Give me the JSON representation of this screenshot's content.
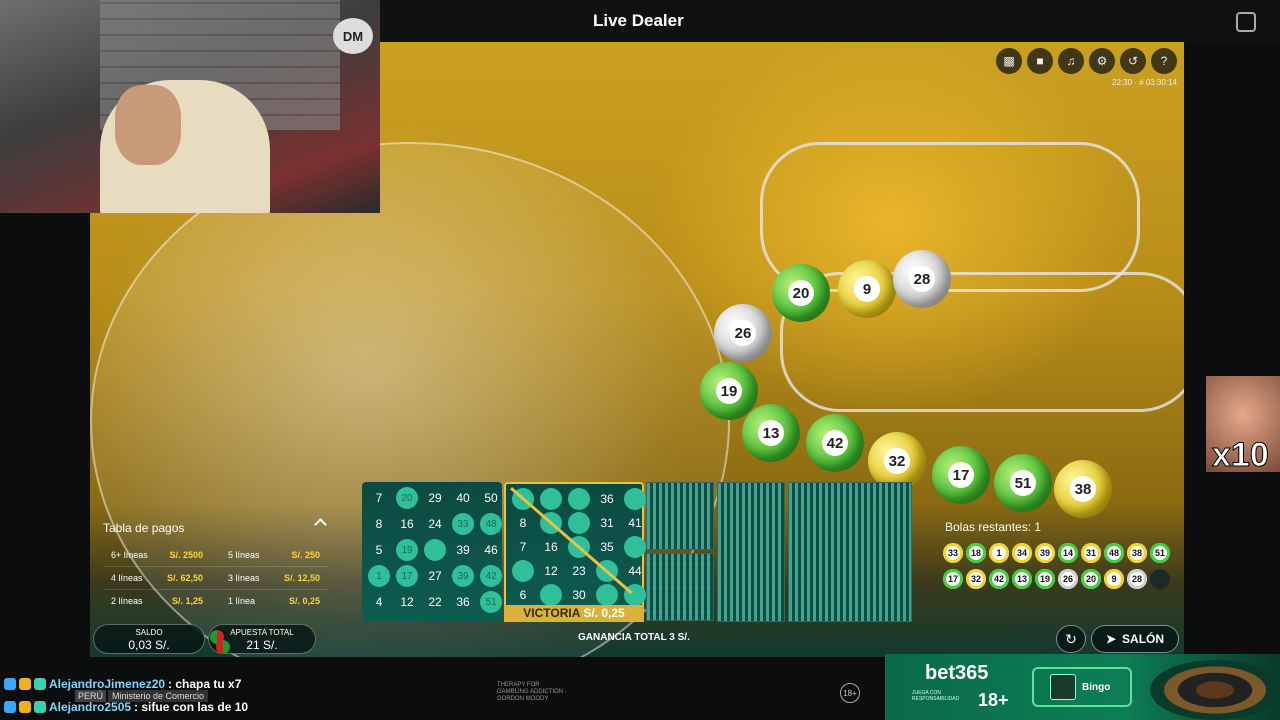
{
  "header": {
    "title": "Live Dealer"
  },
  "toolbar": {
    "icons": [
      "chat-icon",
      "video-icon",
      "volume-icon",
      "gear-icon",
      "history-icon",
      "help-icon"
    ],
    "stream_time": "22:30 · # 03:30:14"
  },
  "webcam": {
    "logo": "DM"
  },
  "video_balls": [
    {
      "n": "20",
      "c": "green"
    },
    {
      "n": "9",
      "c": "yellow"
    },
    {
      "n": "28",
      "c": "white"
    },
    {
      "n": "26",
      "c": "white"
    },
    {
      "n": "19",
      "c": "green"
    },
    {
      "n": "13",
      "c": "green"
    },
    {
      "n": "42",
      "c": "green"
    },
    {
      "n": "32",
      "c": "yellow"
    },
    {
      "n": "17",
      "c": "green"
    },
    {
      "n": "51",
      "c": "green"
    },
    {
      "n": "38",
      "c": "yellow"
    }
  ],
  "paytable": {
    "title": "Tabla de pagos",
    "rows": [
      {
        "l1": "6+ líneas",
        "v1": "S/. 2500",
        "l2": "5 líneas",
        "v2": "S/. 250"
      },
      {
        "l1": "4 líneas",
        "v1": "S/. 62,50",
        "l2": "3 líneas",
        "v2": "S/. 12,50"
      },
      {
        "l1": "2 líneas",
        "v1": "S/. 1,25",
        "l2": "1 línea",
        "v2": "S/. 0,25"
      }
    ]
  },
  "balance": {
    "label": "SALDO",
    "value": "0,03 S/."
  },
  "bet": {
    "label": "APUESTA TOTAL",
    "value": "21 S/."
  },
  "cards": [
    {
      "cells": [
        [
          "7",
          "20",
          "29",
          "40",
          "50"
        ],
        [
          "8",
          "16",
          "24",
          "33",
          "48"
        ],
        [
          "5",
          "19",
          "",
          "39",
          "46"
        ],
        [
          "1",
          "17",
          "27",
          "39",
          "42"
        ],
        [
          "4",
          "12",
          "22",
          "36",
          "51"
        ]
      ],
      "marked": [
        [
          0,
          1
        ],
        [
          1,
          3
        ],
        [
          1,
          4
        ],
        [
          2,
          1
        ],
        [
          2,
          2
        ],
        [
          3,
          0
        ],
        [
          3,
          1
        ],
        [
          3,
          3
        ],
        [
          3,
          4
        ],
        [
          4,
          4
        ]
      ]
    },
    {
      "cells": [
        [
          "",
          "",
          "",
          "36",
          ""
        ],
        [
          "8",
          "",
          "",
          "31",
          "41"
        ],
        [
          "7",
          "16",
          "",
          "35",
          ""
        ],
        [
          "",
          "12",
          "23",
          "",
          "44"
        ],
        [
          "6",
          "",
          "30",
          "",
          ""
        ]
      ],
      "marked": [
        [
          0,
          0
        ],
        [
          0,
          1
        ],
        [
          0,
          2
        ],
        [
          0,
          4
        ],
        [
          1,
          1
        ],
        [
          1,
          2
        ],
        [
          2,
          2
        ],
        [
          2,
          4
        ],
        [
          3,
          0
        ],
        [
          3,
          3
        ],
        [
          4,
          1
        ],
        [
          4,
          3
        ],
        [
          4,
          4
        ]
      ]
    }
  ],
  "victory": {
    "label": "VICTORIA",
    "amount": "S/. 0,25"
  },
  "total_win": {
    "label": "GANANCIA TOTAL",
    "amount": "3 S/."
  },
  "drawn": {
    "label": "Bolas restantes: 1",
    "balls": [
      {
        "n": "33",
        "c": "yellow"
      },
      {
        "n": "18",
        "c": "green"
      },
      {
        "n": "1",
        "c": "yellow"
      },
      {
        "n": "34",
        "c": "yellow"
      },
      {
        "n": "39",
        "c": "yellow"
      },
      {
        "n": "14",
        "c": "green"
      },
      {
        "n": "31",
        "c": "yellow"
      },
      {
        "n": "48",
        "c": "green"
      },
      {
        "n": "38",
        "c": "yellow"
      },
      {
        "n": "51",
        "c": "green"
      },
      {
        "n": "17",
        "c": "green"
      },
      {
        "n": "32",
        "c": "yellow"
      },
      {
        "n": "42",
        "c": "green"
      },
      {
        "n": "13",
        "c": "green"
      },
      {
        "n": "19",
        "c": "green"
      },
      {
        "n": "26",
        "c": "white"
      },
      {
        "n": "20",
        "c": "green"
      },
      {
        "n": "9",
        "c": "yellow"
      },
      {
        "n": "28",
        "c": "white"
      },
      {
        "n": "",
        "c": "empty"
      }
    ]
  },
  "buttons": {
    "lobby": "SALÓN"
  },
  "chat": [
    {
      "user": "AlejandroJimenez20",
      "msg": ": chapa tu x7"
    },
    {
      "user": "Alejandro2505",
      "msg": ": sifue con las de 10"
    }
  ],
  "overlay": {
    "tag1": "PERÚ",
    "tag2": "Ministerio de Comercio",
    "meme": "x10"
  },
  "footer": {
    "gambling": "THERAPY FOR GAMBLING ADDICTION · GORDON MOODY",
    "age": "18+"
  },
  "banner": {
    "brand": "bet365",
    "age": "18+",
    "small": "JUEGA CON RESPONSABILIDAD",
    "bingo": "Bingo"
  },
  "colors": {
    "accent": "#e6c340",
    "card": "#0b4a42",
    "win": "#ffd43a"
  }
}
